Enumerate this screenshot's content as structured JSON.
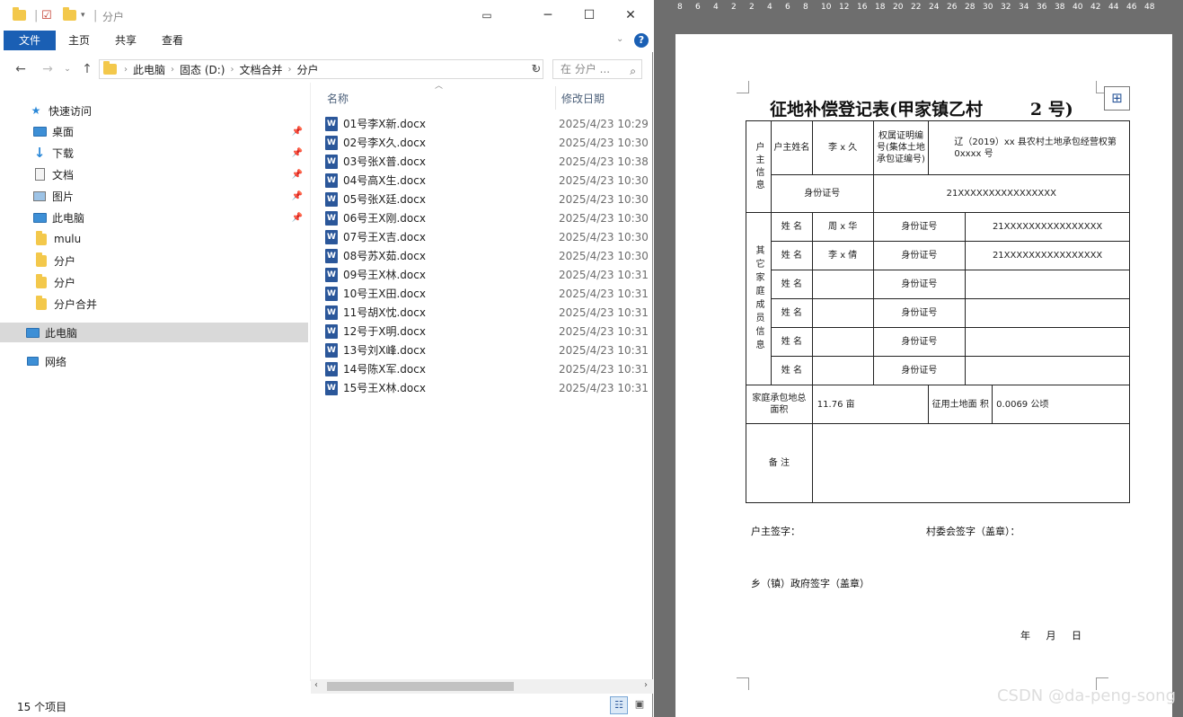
{
  "window": {
    "title": "分户",
    "menu_tabs": [
      "文件",
      "主页",
      "共享",
      "查看"
    ]
  },
  "address": {
    "crumbs": [
      "此电脑",
      "固态 (D:)",
      "文档合并",
      "分户"
    ],
    "search_placeholder": "在 分户 ..."
  },
  "nav": {
    "quick_access": "快速访问",
    "pinned": [
      {
        "label": "桌面",
        "icon": "desktop-icon"
      },
      {
        "label": "下载",
        "icon": "download-icon"
      },
      {
        "label": "文档",
        "icon": "document-icon"
      },
      {
        "label": "图片",
        "icon": "pictures-icon"
      },
      {
        "label": "此电脑",
        "icon": "computer-icon"
      }
    ],
    "folders": [
      "mulu",
      "分户",
      "分户",
      "分户合并"
    ],
    "this_pc": "此电脑",
    "network": "网络"
  },
  "columns": {
    "name": "名称",
    "modified": "修改日期"
  },
  "files": [
    {
      "name": "01号李X新.docx",
      "date": "2025/4/23 10:29"
    },
    {
      "name": "02号李X久.docx",
      "date": "2025/4/23 10:30"
    },
    {
      "name": "03号张X普.docx",
      "date": "2025/4/23 10:38"
    },
    {
      "name": "04号高X生.docx",
      "date": "2025/4/23 10:30"
    },
    {
      "name": "05号张X廷.docx",
      "date": "2025/4/23 10:30"
    },
    {
      "name": "06号王X刚.docx",
      "date": "2025/4/23 10:30"
    },
    {
      "name": "07号王X吉.docx",
      "date": "2025/4/23 10:30"
    },
    {
      "name": "08号苏X茹.docx",
      "date": "2025/4/23 10:30"
    },
    {
      "name": "09号王X林.docx",
      "date": "2025/4/23 10:31"
    },
    {
      "name": "10号王X田.docx",
      "date": "2025/4/23 10:31"
    },
    {
      "name": "11号胡X忱.docx",
      "date": "2025/4/23 10:31"
    },
    {
      "name": "12号于X明.docx",
      "date": "2025/4/23 10:31"
    },
    {
      "name": "13号刘X峰.docx",
      "date": "2025/4/23 10:31"
    },
    {
      "name": "14号陈X军.docx",
      "date": "2025/4/23 10:31"
    },
    {
      "name": "15号王X林.docx",
      "date": "2025/4/23 10:31"
    }
  ],
  "status": {
    "count": "15 个项目"
  },
  "ruler": {
    "ticks": [
      "8",
      "6",
      "4",
      "2",
      "2",
      "4",
      "6",
      "8",
      "10",
      "12",
      "16",
      "18",
      "20",
      "22",
      "24",
      "26",
      "28",
      "30",
      "32",
      "34",
      "36",
      "38",
      "40",
      "42",
      "44",
      "46",
      "48"
    ]
  },
  "doc": {
    "title": "征地补偿登记表(甲家镇乙村        2 号)",
    "household_info": "户主信息",
    "head_name_label": "户主姓名",
    "head_name": "李 x 久",
    "cert_label": "权属证明编号(集体土地承包证编号)",
    "cert_value": "辽（2019）xx 县农村土地承包经营权第0xxxx 号",
    "id_label": "身份证号",
    "head_id": "21XXXXXXXXXXXXXXXX",
    "other_members_label": "其它家庭成员信息",
    "member_name_label": "姓  名",
    "member_id_label": "身份证号",
    "members": [
      {
        "name": "周 x 华",
        "id": "21XXXXXXXXXXXXXXXX"
      },
      {
        "name": "李 x 倩",
        "id": "21XXXXXXXXXXXXXXXX"
      },
      {
        "name": "",
        "id": ""
      },
      {
        "name": "",
        "id": ""
      },
      {
        "name": "",
        "id": ""
      },
      {
        "name": "",
        "id": ""
      }
    ],
    "family_area_label": "家庭承包地总面积",
    "family_area": "11.76 亩",
    "land_area_label": "征用土地面   积",
    "land_area": "0.0069 公顷",
    "remarks_label": "备  注",
    "sign_head": "户主签字：",
    "sign_village": "村委会签字（盖章）：",
    "sign_gov": "乡（镇）政府签字（盖章）",
    "date_line": "年     月     日"
  },
  "watermark": "CSDN @da-peng-song"
}
